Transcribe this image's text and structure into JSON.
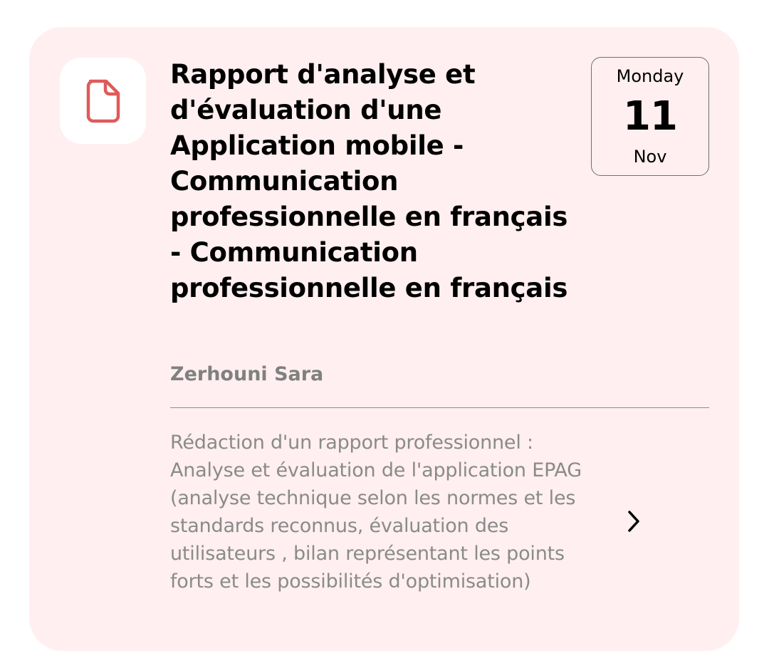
{
  "card": {
    "icon": "document-icon",
    "title": "Rapport d'analyse et d'évaluation d'une Application mobile - Communication professionnelle en français - Communication professionnelle en français",
    "date": {
      "weekday": "Monday",
      "day": "11",
      "month": "Nov"
    },
    "author": "Zerhouni Sara",
    "description": "Rédaction d'un rapport professionnel : Analyse et évaluation de l'application EPAG (analyse technique selon les normes et les standards reconnus, évaluation des utilisateurs , bilan représentant les points forts et les possibilités d'optimisation)",
    "chevron_icon": "chevron-right-icon"
  },
  "colors": {
    "card_background": "#ffeff0",
    "icon_tile_background": "#ffffff",
    "icon_accent": "#e05a5a",
    "title_text": "#000000",
    "author_text": "#808080",
    "description_text": "#8a8a8a",
    "divider": "#8c8c8c"
  }
}
